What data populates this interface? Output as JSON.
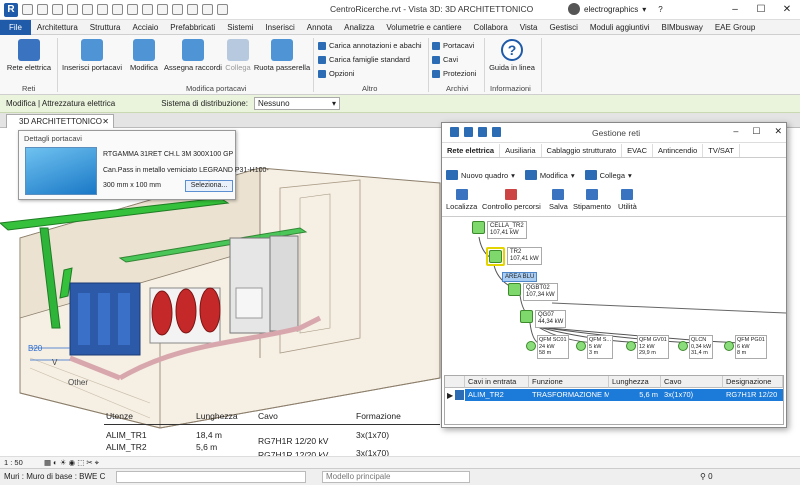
{
  "app": {
    "window_title": "CentroRicerche.rvt - Vista 3D: 3D ARCHITETTONICO",
    "account": "electrographics",
    "logo": "R"
  },
  "menu": [
    "File",
    "Architettura",
    "Struttura",
    "Acciaio",
    "Prefabbricati",
    "Sistemi",
    "Inserisci",
    "Annota",
    "Analizza",
    "Volumetrie e cantiere",
    "Collabora",
    "Vista",
    "Gestisci",
    "Moduli aggiuntivi",
    "BIMbusway",
    "EAE Group"
  ],
  "ribbon": {
    "rete_elettrica": "Rete elettrica",
    "inserisci_portacavi": "Inserisci portacavi",
    "modifica": "Modifica",
    "assegna_raccordi": "Assegna raccordi",
    "collega": "Collega",
    "ruota_passerella": "Ruota passerella",
    "carica_annotazioni": "Carica annotazioni e abachi",
    "carica_famiglie": "Carica famiglie standard",
    "opzioni": "Opzioni",
    "portacavi": "Portacavi",
    "cavi": "Cavi",
    "protezioni": "Protezioni",
    "guida": "Guida in linea",
    "groups": {
      "reti": "Reti",
      "modifica_portacavi": "Modifica portacavi",
      "altro": "Altro",
      "archivi": "Archivi",
      "informazioni": "Informazioni"
    }
  },
  "context_bar": {
    "label": "Modifica | Attrezzatura elettrica",
    "system_label": "Sistema di distribuzione:",
    "system_value": "Nessuno"
  },
  "view_tab": {
    "label": "3D ARCHITETTONICO"
  },
  "cable_details": {
    "header": "Dettagli portacavi",
    "code": "RTGAMMA 31RET CH.L 3M 300X100 GP",
    "description": "Can.Pass in metallo verniciato LEGRAND P31-H100-",
    "size": "300 mm x 100 mm",
    "select_button": "Seleziona..."
  },
  "cable_table": {
    "headers": [
      "Utenze",
      "Lunghezza",
      "Cavo",
      "Formazione"
    ],
    "rows": [
      [
        "ALIM_TR1",
        "18,4 m",
        "RG7H1R 12/20 kV",
        "3x(1x70)"
      ],
      [
        "ALIM_TR2",
        "5,6 m",
        "RG7H1R 12/20 kV",
        "3x(1x70)"
      ]
    ]
  },
  "viewport_labels": {
    "other": "Other",
    "b20": "B20",
    "v_mark": "V"
  },
  "gestione": {
    "title": "Gestione reti",
    "tabs": [
      "Rete elettrica",
      "Ausiliaria",
      "Cablaggio strutturato",
      "EVAC",
      "Antincendio",
      "TV/SAT"
    ],
    "toolbar1": [
      "Nuovo quadro",
      "Modifica",
      "Collega"
    ],
    "toolbar2": [
      "Localizza",
      "Controllo percorsi",
      "Salva",
      "Stipamento",
      "Utilità"
    ],
    "nodes": [
      {
        "name": "CELLA_TR2",
        "value": "107,41 kW"
      },
      {
        "name": "TR2",
        "value": "107,41 kW"
      },
      {
        "name": "QGBT02",
        "value": "107,34 kW"
      },
      {
        "name": "QG07",
        "value": "44,34 kW"
      }
    ],
    "area": "AREA BLU",
    "leaves": [
      {
        "name": "QFM SC01",
        "l1": "24 kW",
        "l2": "58 m"
      },
      {
        "name": "QFM S...",
        "l1": "5 kW",
        "l2": "3 m"
      },
      {
        "name": "QFM GV01",
        "l1": "12 kW",
        "l2": "29,9 m"
      },
      {
        "name": "QLCN",
        "l1": "0,34 kW",
        "l2": "31,4 m"
      },
      {
        "name": "QFM PG01",
        "l1": "6 kW",
        "l2": "8 m"
      }
    ],
    "grid": {
      "headers": [
        "Cavi in entrata",
        "Funzione",
        "Lunghezza",
        "Cavo",
        "Designazione"
      ],
      "row": [
        "ALIM_TR2",
        "TRASFORMAZIONE M",
        "5,6 m",
        "3x(1x70)",
        "RG7H1R 12/20"
      ]
    }
  },
  "scale": "1 : 50",
  "status": {
    "left": "Muri : Muro di base : BWE C",
    "model": "Modello principale"
  },
  "colors": {
    "accent": "#1f5ba8",
    "selection": "#1c7ad8",
    "context": "#eaf3dc"
  }
}
